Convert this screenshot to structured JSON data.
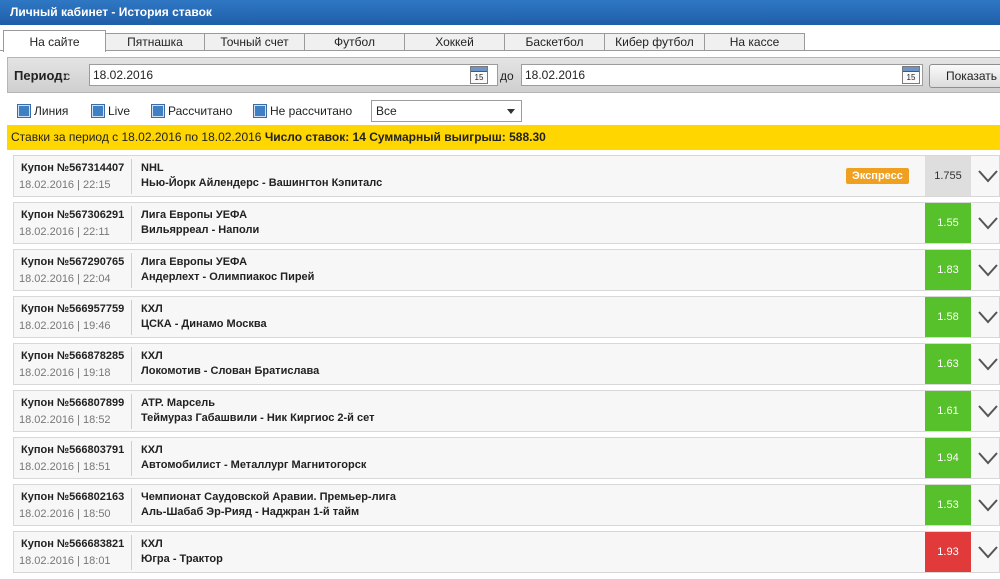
{
  "window": {
    "title": "Личный кабинет - История ставок"
  },
  "tabs": [
    {
      "label": "На сайте",
      "active": true
    },
    {
      "label": "Пятнашка",
      "active": false
    },
    {
      "label": "Точный счет",
      "active": false
    },
    {
      "label": "Футбол",
      "active": false
    },
    {
      "label": "Хоккей",
      "active": false
    },
    {
      "label": "Баскетбол",
      "active": false
    },
    {
      "label": "Кибер футбол",
      "active": false
    },
    {
      "label": "На кассе",
      "active": false
    }
  ],
  "period": {
    "label": "Период:",
    "from_label": "с",
    "from_value": "18.02.2016",
    "to_label": "до",
    "to_value": "18.02.2016",
    "calendar_day": "15",
    "show_button": "Показать"
  },
  "filters": {
    "items": [
      {
        "label": "Линия",
        "checked": true
      },
      {
        "label": "Live",
        "checked": true
      },
      {
        "label": "Рассчитано",
        "checked": true
      },
      {
        "label": "Не рассчитано",
        "checked": true
      }
    ],
    "select_value": "Все"
  },
  "summary": {
    "period_text": "Ставки за период с 18.02.2016 по 18.02.2016",
    "count_text": "Число ставок: 14 Суммарный выигрыш: 588.30"
  },
  "colors": {
    "accent_green": "#56c12a",
    "accent_red": "#e03a3a",
    "summary_bg": "#ffd600",
    "titlebar": "#1f5ea8"
  },
  "bets": [
    {
      "coupon": "Купон №567314407",
      "datetime": "18.02.2016 | 22:15",
      "league": "NHL",
      "match": "Нью-Йорк Айлендерс - Вашингтон Кэпиталс",
      "badge": "Экспресс",
      "coef": "1.755",
      "status": "gray"
    },
    {
      "coupon": "Купон №567306291",
      "datetime": "18.02.2016 | 22:11",
      "league": "Лига Европы УЕФА",
      "match": "Вильярреал - Наполи",
      "badge": "",
      "coef": "1.55",
      "status": "green"
    },
    {
      "coupon": "Купон №567290765",
      "datetime": "18.02.2016 | 22:04",
      "league": "Лига Европы УЕФА",
      "match": "Андерлехт - Олимпиакос Пирей",
      "badge": "",
      "coef": "1.83",
      "status": "green"
    },
    {
      "coupon": "Купон №566957759",
      "datetime": "18.02.2016 | 19:46",
      "league": "КХЛ",
      "match": "ЦСКА - Динамо Москва",
      "badge": "",
      "coef": "1.58",
      "status": "green"
    },
    {
      "coupon": "Купон №566878285",
      "datetime": "18.02.2016 | 19:18",
      "league": "КХЛ",
      "match": "Локомотив - Слован Братислава",
      "badge": "",
      "coef": "1.63",
      "status": "green"
    },
    {
      "coupon": "Купон №566807899",
      "datetime": "18.02.2016 | 18:52",
      "league": "ATP. Марсель",
      "match": "Теймураз Габашвили - Ник Киргиос 2-й сет",
      "badge": "",
      "coef": "1.61",
      "status": "green"
    },
    {
      "coupon": "Купон №566803791",
      "datetime": "18.02.2016 | 18:51",
      "league": "КХЛ",
      "match": "Автомобилист - Металлург Магнитогорск",
      "badge": "",
      "coef": "1.94",
      "status": "green"
    },
    {
      "coupon": "Купон №566802163",
      "datetime": "18.02.2016 | 18:50",
      "league": "Чемпионат Саудовской Аравии. Премьер-лига",
      "match": "Аль-Шабаб Эр-Рияд - Наджран 1-й тайм",
      "badge": "",
      "coef": "1.53",
      "status": "green"
    },
    {
      "coupon": "Купон №566683821",
      "datetime": "18.02.2016 | 18:01",
      "league": "КХЛ",
      "match": "Югра - Трактор",
      "badge": "",
      "coef": "1.93",
      "status": "red"
    }
  ]
}
